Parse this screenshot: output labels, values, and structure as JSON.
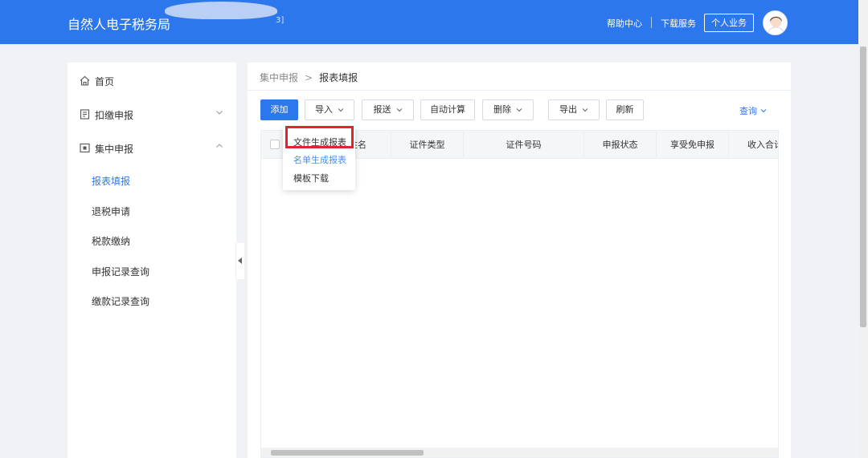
{
  "header": {
    "brand": "自然人电子税务局",
    "blurred_text": "3]",
    "help_center": "帮助中心",
    "download_service": "下载服务",
    "personal_business": "个人业务"
  },
  "sidebar": {
    "home": "首页",
    "withholding": "扣缴申报",
    "centralized": "集中申报",
    "sub_items": [
      "报表填报",
      "退税申请",
      "税款缴纳",
      "申报记录查询",
      "缴款记录查询"
    ]
  },
  "breadcrumb": {
    "parent": "集中申报",
    "separator": ">",
    "current": "报表填报"
  },
  "toolbar": {
    "add": "添加",
    "import": "导入",
    "submit": "报送",
    "auto_calc": "自动计算",
    "delete": "删除",
    "export": "导出",
    "refresh": "刷新",
    "query": "查询"
  },
  "table": {
    "headers": [
      "姓名",
      "证件类型",
      "证件号码",
      "申报状态",
      "享受免申报",
      "收入合计"
    ]
  },
  "import_menu": {
    "items": [
      "文件生成报表",
      "名单生成报表",
      "模板下载"
    ]
  },
  "colors": {
    "primary": "#2d77ed",
    "highlight_box": "#e0252b"
  }
}
